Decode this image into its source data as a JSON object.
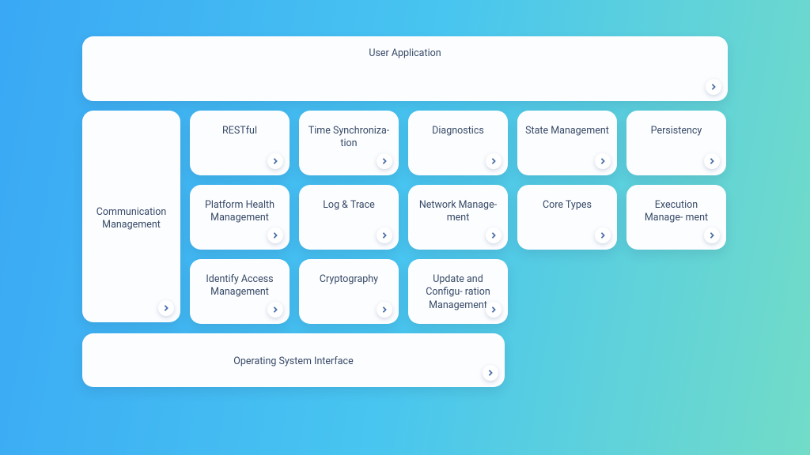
{
  "top": {
    "label": "User Application"
  },
  "left": {
    "label": "Communication Management"
  },
  "grid": [
    {
      "label": "RESTful"
    },
    {
      "label": "Time Synchroniza-\ntion"
    },
    {
      "label": "Diagnostics"
    },
    {
      "label": "State Management"
    },
    {
      "label": "Persistency"
    },
    {
      "label": "Platform Health Management"
    },
    {
      "label": "Log & Trace"
    },
    {
      "label": "Network Manage-\nment"
    },
    {
      "label": "Core Types"
    },
    {
      "label": "Execution Manage-\nment"
    },
    {
      "label": "Identify Access Management"
    },
    {
      "label": "Cryptography"
    },
    {
      "label": "Update and Configu-\nration Management"
    }
  ],
  "bottom": {
    "label": "Operating System Interface"
  }
}
